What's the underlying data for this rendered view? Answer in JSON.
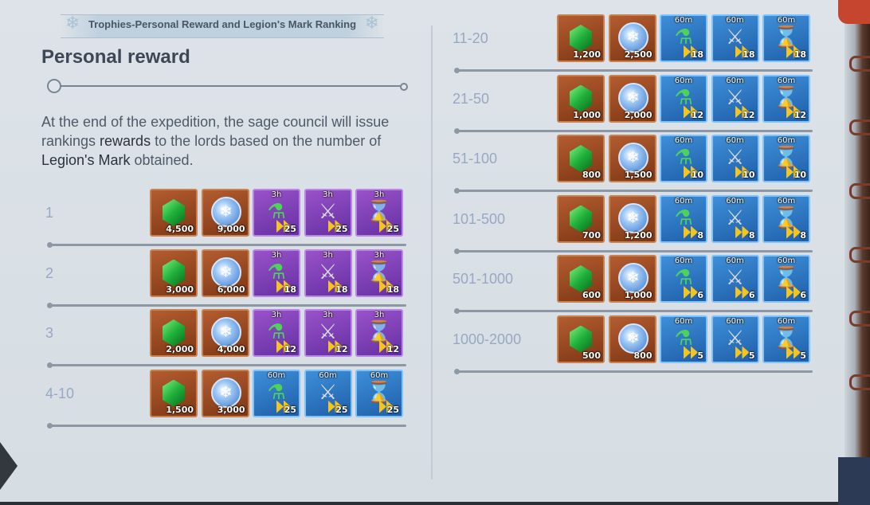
{
  "banner": {
    "title": "Trophies-Personal Reward and Legion's Mark Ranking"
  },
  "heading": "Personal reward",
  "description": {
    "part1": "At the end of the expedition, the sage council will issue rankings ",
    "bold1": "rewards",
    "part2": " to the lords based on the number of ",
    "bold2": "Legion's Mark",
    "part3": " obtained."
  },
  "icons": {
    "gem": "green-gem-icon",
    "coin": "snowflake-coin-icon",
    "potion": "speedup-potion-icon",
    "sword": "speedup-sword-icon",
    "hourglass": "speedup-hourglass-icon"
  },
  "colors": {
    "orange_slot": "#9a4a22",
    "purple_slot": "#7b3fb6",
    "blue_slot": "#2d74c0"
  },
  "rankings": [
    {
      "rank": "1",
      "gems": "4,500",
      "coins": "9,000",
      "duration": "3h",
      "speedups": [
        "25",
        "25",
        "25"
      ],
      "tier": "purple"
    },
    {
      "rank": "2",
      "gems": "3,000",
      "coins": "6,000",
      "duration": "3h",
      "speedups": [
        "18",
        "18",
        "18"
      ],
      "tier": "purple"
    },
    {
      "rank": "3",
      "gems": "2,000",
      "coins": "4,000",
      "duration": "3h",
      "speedups": [
        "12",
        "12",
        "12"
      ],
      "tier": "purple"
    },
    {
      "rank": "4-10",
      "gems": "1,500",
      "coins": "3,000",
      "duration": "60m",
      "speedups": [
        "25",
        "25",
        "25"
      ],
      "tier": "blue"
    },
    {
      "rank": "11-20",
      "gems": "1,200",
      "coins": "2,500",
      "duration": "60m",
      "speedups": [
        "18",
        "18",
        "18"
      ],
      "tier": "blue"
    },
    {
      "rank": "21-50",
      "gems": "1,000",
      "coins": "2,000",
      "duration": "60m",
      "speedups": [
        "12",
        "12",
        "12"
      ],
      "tier": "blue"
    },
    {
      "rank": "51-100",
      "gems": "800",
      "coins": "1,500",
      "duration": "60m",
      "speedups": [
        "10",
        "10",
        "10"
      ],
      "tier": "blue"
    },
    {
      "rank": "101-500",
      "gems": "700",
      "coins": "1,200",
      "duration": "60m",
      "speedups": [
        "8",
        "8",
        "8"
      ],
      "tier": "blue"
    },
    {
      "rank": "501-1000",
      "gems": "600",
      "coins": "1,000",
      "duration": "60m",
      "speedups": [
        "6",
        "6",
        "6"
      ],
      "tier": "blue"
    },
    {
      "rank": "1000-2000",
      "gems": "500",
      "coins": "800",
      "duration": "60m",
      "speedups": [
        "5",
        "5",
        "5"
      ],
      "tier": "blue"
    }
  ]
}
